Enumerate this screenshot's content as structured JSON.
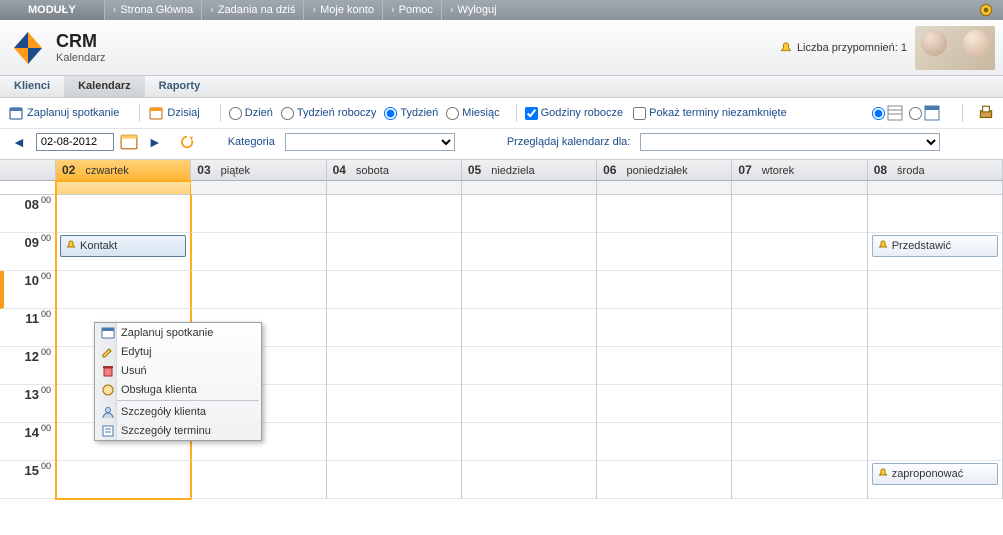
{
  "topnav": {
    "modules_label": "MODUŁY",
    "items": [
      "Strona Główna",
      "Zadania na dziś",
      "Moje konto",
      "Pomoc",
      "Wyloguj"
    ]
  },
  "header": {
    "title": "CRM",
    "subtitle": "Kalendarz",
    "reminder_label": "Liczba przypomnień: 1"
  },
  "subnav": {
    "items": [
      "Klienci",
      "Kalendarz",
      "Raporty"
    ],
    "active": "Kalendarz"
  },
  "toolbar": {
    "plan_meeting": "Zaplanuj spotkanie",
    "today": "Dzisiaj",
    "view_day": "Dzień",
    "view_workweek": "Tydzień roboczy",
    "view_week": "Tydzień",
    "view_month": "Miesiąc",
    "work_hours": "Godziny robocze",
    "show_open": "Pokaż terminy niezamknięte"
  },
  "toolbar2": {
    "date": "02-08-2012",
    "category_label": "Kategoria",
    "browse_for_label": "Przeglądaj kalendarz dla:"
  },
  "calendar": {
    "days": [
      {
        "num": "02",
        "name": "czwartek",
        "current": true
      },
      {
        "num": "03",
        "name": "piątek"
      },
      {
        "num": "04",
        "name": "sobota"
      },
      {
        "num": "05",
        "name": "niedziela"
      },
      {
        "num": "06",
        "name": "poniedziałek"
      },
      {
        "num": "07",
        "name": "wtorek"
      },
      {
        "num": "08",
        "name": "środa"
      }
    ],
    "hours": [
      "08",
      "09",
      "10",
      "11",
      "12",
      "13",
      "14",
      "15"
    ],
    "now_hour": "10"
  },
  "events": {
    "e1": "Kontakt",
    "e2": "Przedstawić",
    "e3": "zaproponować"
  },
  "context_menu": {
    "items": {
      "plan": "Zaplanuj spotkanie",
      "edit": "Edytuj",
      "del": "Usuń",
      "service": "Obsługa klienta",
      "client_details": "Szczegóły klienta",
      "term_details": "Szczegóły terminu"
    }
  }
}
